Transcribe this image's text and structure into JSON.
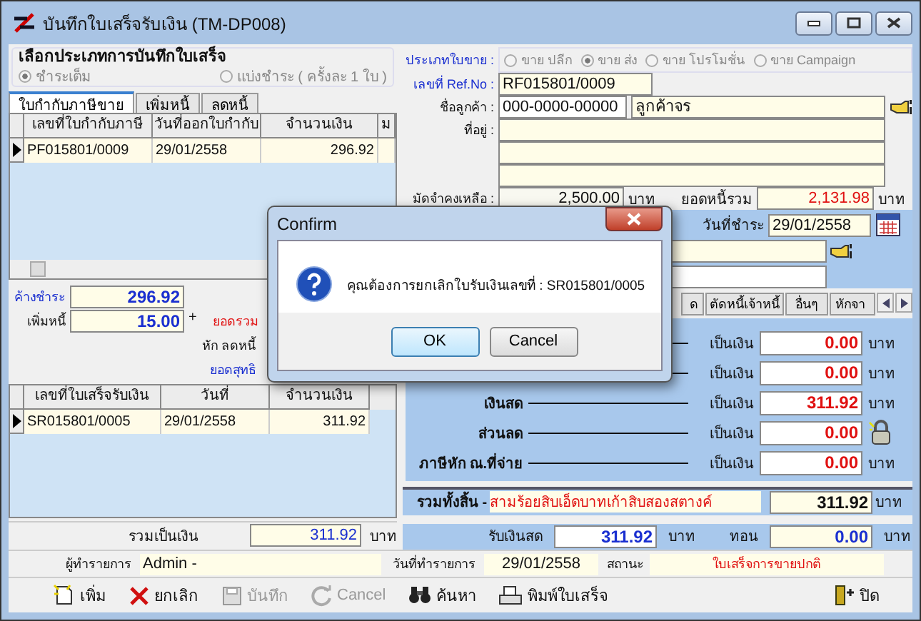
{
  "window": {
    "title": "บันทึกใบเสร็จรับเงิน (TM-DP008)"
  },
  "payment_mode": {
    "title": "เลือกประเภทการบันทึกใบเสร็จ",
    "options": [
      {
        "label": "ชำระเต็ม",
        "selected": true
      },
      {
        "label": "แบ่งชำระ ( ครั้งละ 1 ใบ )",
        "selected": false
      }
    ]
  },
  "invoice_tabs": [
    {
      "label": "ใบกำกับภาษีขาย",
      "selected": true
    },
    {
      "label": "เพิ่มหนี้",
      "selected": false
    },
    {
      "label": "ลดหนี้",
      "selected": false
    }
  ],
  "invoice_table": {
    "columns": [
      "เลขที่ใบกำกับภาษี",
      "วันที่ออกใบกำกับ",
      "จำนวนเงิน",
      "ม"
    ],
    "rows": [
      {
        "cells": [
          "PF015801/0009",
          "29/01/2558",
          "296.92"
        ],
        "selected": true
      }
    ]
  },
  "balances": {
    "outstanding_label": "ค้างชำระ",
    "outstanding": "296.92",
    "added_debt_label": "เพิ่มหนี้",
    "added_debt": "15.00",
    "plus": "+",
    "total_label": "ยอดรวม",
    "credit_label": "หัก ลดหนี้",
    "net_label": "ยอดสุทธิ"
  },
  "receipt_table": {
    "columns": [
      "เลขที่ใบเสร็จรับเงิน",
      "วันที่",
      "จำนวนเงิน"
    ],
    "rows": [
      {
        "cells": [
          "SR015801/0005",
          "29/01/2558",
          "311.92"
        ],
        "selected": true
      }
    ]
  },
  "receipt_total": {
    "label": "รวมเป็นเงิน",
    "value": "311.92",
    "unit": "บาท"
  },
  "sale_type": {
    "label": "ประเภทใบขาย :",
    "options": [
      {
        "label": "ขาย ปลีก",
        "selected": false
      },
      {
        "label": "ขาย ส่ง",
        "selected": true
      },
      {
        "label": "ขาย โปรโมชั่น",
        "selected": false
      },
      {
        "label": "ขาย Campaign",
        "selected": false
      }
    ]
  },
  "ref": {
    "label": "เลขที่ Ref.No :",
    "value": "RF015801/0009"
  },
  "customer": {
    "label": "ชื่อลูกค้า :",
    "code": "000-0000-00000",
    "name": "ลูกค้าจร"
  },
  "address": {
    "label": "ที่อยู่ :"
  },
  "deposit": {
    "label": "มัดจำคงเหลือ :",
    "value": "2,500.00",
    "unit": "บาท"
  },
  "total_debt": {
    "label": "ยอดหนี้รวม",
    "value": "2,131.98",
    "unit": "บาท"
  },
  "payment_date": {
    "label": "วันที่ชำระ",
    "value": "29/01/2558"
  },
  "payment_tabs": [
    {
      "label": "ด",
      "selected": false
    },
    {
      "label": "ตัดหนี้เจ้าหนี้",
      "selected": false
    },
    {
      "label": "อื่นๆ",
      "selected": false
    },
    {
      "label": "หักจา",
      "selected": false
    }
  ],
  "payment_rows": [
    {
      "kind": "unit",
      "amount_label": "เป็นเงิน",
      "value": "0.00",
      "unit": "บาท"
    },
    {
      "kind": "unit",
      "amount_label": "เป็นเงิน",
      "value": "0.00",
      "unit": "บาท"
    },
    {
      "kind": "unit",
      "label": "เงินสด",
      "amount_label": "เป็นเงิน",
      "value": "311.92",
      "unit": "บาท"
    },
    {
      "kind": "lock",
      "label": "ส่วนลด",
      "amount_label": "เป็นเงิน",
      "value": "0.00"
    },
    {
      "kind": "unit",
      "label": "ภาษีหัก ณ.ที่จ่าย",
      "amount_label": "เป็นเงิน",
      "value": "0.00",
      "unit": "บาท"
    }
  ],
  "grand_total": {
    "label": "รวมทั้งสิ้น -",
    "words": "สามร้อยสิบเอ็ดบาทเก้าสิบสองสตางค์",
    "value": "311.92",
    "unit": "บาท"
  },
  "cash": {
    "label": "รับเงินสด",
    "value": "311.92",
    "unit": "บาท",
    "change_label": "ทอน",
    "change": "0.00",
    "change_unit": "บาท"
  },
  "footer": {
    "user_label": "ผู้ทำรายการ",
    "user": "Admin -",
    "date_label": "วันที่ทำรายการ",
    "date": "29/01/2558",
    "status_label": "สถานะ",
    "status": "ใบเสร็จการขายปกติ"
  },
  "toolbar": [
    {
      "label": "เพิ่ม",
      "kind": "new",
      "disabled": false
    },
    {
      "label": "ยกเลิก",
      "kind": "delete",
      "disabled": false
    },
    {
      "label": "บันทึก",
      "kind": "save",
      "disabled": true
    },
    {
      "label": "Cancel",
      "kind": "undo",
      "disabled": true
    },
    {
      "label": "ค้นหา",
      "kind": "find",
      "disabled": false
    },
    {
      "label": "พิมพ์ใบเสร็จ",
      "kind": "print",
      "disabled": false
    },
    {
      "label": "ปิด",
      "kind": "exit",
      "disabled": false
    }
  ],
  "dialog": {
    "title": "Confirm",
    "message": "คุณต้องการยกเลิกใบรับเงินเลขที่ : SR015801/0005",
    "buttons": [
      {
        "label": "OK",
        "selected": true
      },
      {
        "label": "Cancel",
        "selected": false
      }
    ]
  }
}
